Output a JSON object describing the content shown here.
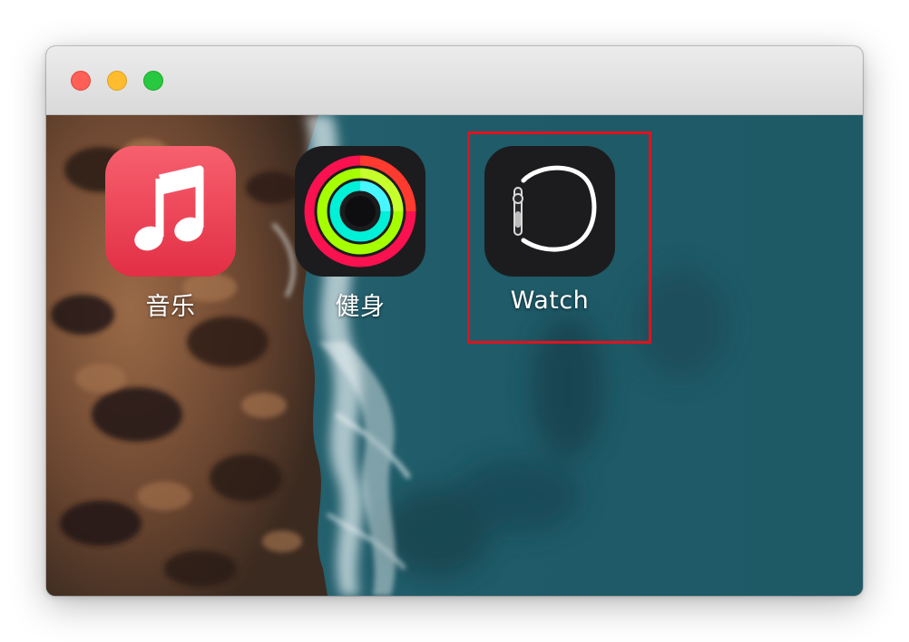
{
  "window": {
    "controls": [
      "close",
      "minimize",
      "zoom"
    ],
    "colors": {
      "close": "#fe5f57",
      "minimize": "#febc2e",
      "zoom": "#28c840"
    }
  },
  "apps": [
    {
      "label": "音乐",
      "icon": "music-note-icon",
      "color": "#e8414f"
    },
    {
      "label": "健身",
      "icon": "activity-rings-icon",
      "color": "#1c1c1e"
    },
    {
      "label": "Watch",
      "icon": "watch-outline-icon",
      "color": "#1c1c1e"
    }
  ],
  "highlight": {
    "target": "Watch",
    "color": "#e0121e"
  }
}
